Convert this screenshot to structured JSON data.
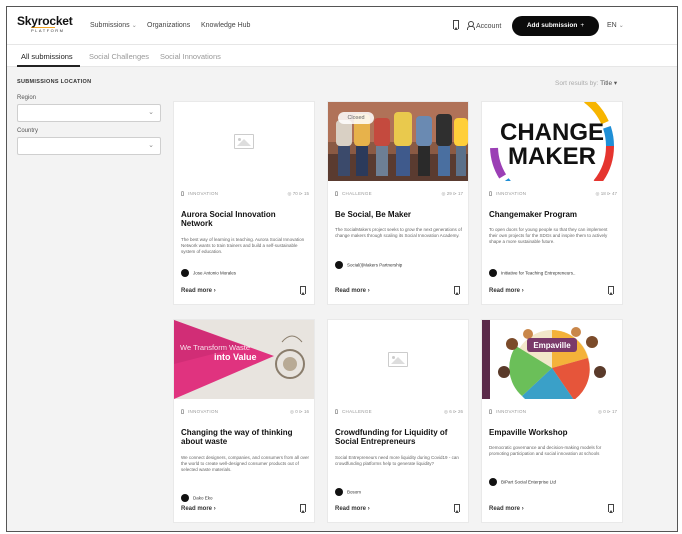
{
  "brand": {
    "name": "Skyrocket",
    "tagline": "PLATFORM"
  },
  "nav": {
    "submissions": "Submissions",
    "organizations": "Organizations",
    "knowledge_hub": "Knowledge Hub",
    "account": "Account",
    "add_submission": "Add submission",
    "add_icon": "+",
    "language": "EN"
  },
  "tabs": [
    {
      "label": "All submissions",
      "active": true
    },
    {
      "label": "Social Challenges",
      "active": false
    },
    {
      "label": "Social Innovations",
      "active": false
    }
  ],
  "filters": {
    "section_title": "SUBMISSIONS LOCATION",
    "region_label": "Region",
    "region_value": "",
    "country_label": "Country",
    "country_value": ""
  },
  "sort": {
    "label": "Sort results by:",
    "value": "Title"
  },
  "cards": [
    {
      "type": "INNOVATION",
      "stats": "◎ 70   ⊳ 15",
      "title": "Aurora Social Innovation Network",
      "description": "The best way of learning is teaching. Aurora Social Innovation Network wants to train trainers and build a self-sustainable system of education.",
      "author": "Jose Antonio Morales",
      "read_more": "Read more",
      "image": "placeholder"
    },
    {
      "type": "CHALLENGE",
      "stats": "◎ 29   ⊳ 17",
      "title": "Be Social, Be Maker",
      "description": "The SocialMakers project seeks to grow the next generations of change makers through scaling its Social Innovation Academy.",
      "author": "Social(i)Makers Partnership",
      "read_more": "Read more",
      "badge": "Closed",
      "image": "photo-people-sitting"
    },
    {
      "type": "INNOVATION",
      "stats": "◎ 18   ⊳ 47",
      "title": "Changemaker Program",
      "description": "To open doors for young people so that they can implement their own projects for the SDGs and inspire them to actively shape a more sustainable future.",
      "author": "Initiative for Teaching Entrepreneurs..",
      "read_more": "Read more",
      "image": "changemaker-logo",
      "image_text_1": "CHANGE",
      "image_text_2": "MAKER"
    },
    {
      "type": "INNOVATION",
      "stats": "◎ 0   ⊳ 16",
      "title": "Changing the way of thinking about waste",
      "description": "We connect designers, companies, and consumers from all over the world to create well-designed consumer products out of selected waste materials.",
      "author": "Dako Eko",
      "read_more": "Read more",
      "image": "transform-waste",
      "image_text_1": "We Transform Waste",
      "image_text_2": "into Value"
    },
    {
      "type": "CHALLENGE",
      "stats": "◎ 6   ⊳ 26",
      "title": "Crowdfunding for Liquidity of Social Entrepreneurs",
      "description": "Social Entrepreneurs need more liquidity during Covid19 - can crowdfunding platforms help to generate liquidity?",
      "author": "Bosom",
      "read_more": "Read more",
      "image": "placeholder"
    },
    {
      "type": "INNOVATION",
      "stats": "◎ 0   ⊳ 17",
      "title": "Empaville Workshop",
      "description": "Democratic governance and decision-making models for promoting participation and social innovation at schools",
      "author": "BiPart Social Enterprise Ltd",
      "read_more": "Read more",
      "image": "empaville-illustration",
      "image_text_1": "Empaville"
    }
  ],
  "colors": {
    "primary_button": "#0b0b0b",
    "pink_banner": "#e0337f",
    "background": "#f3f3f3"
  }
}
